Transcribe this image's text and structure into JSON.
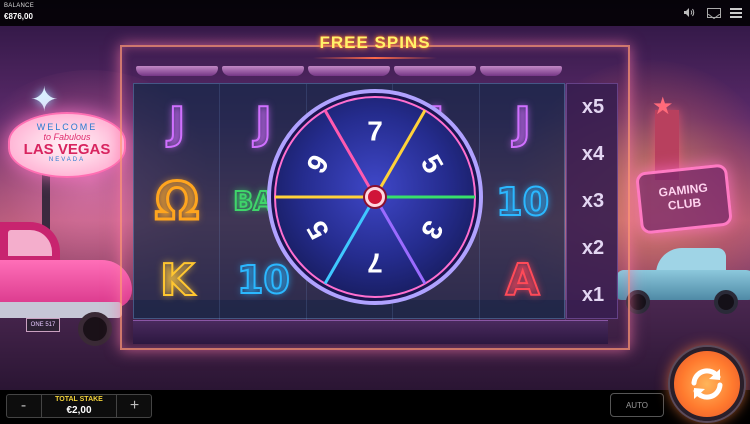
{
  "top_bar": {
    "balance_label": "BALANCE",
    "balance_value": "€876,00",
    "icons": [
      "speaker-icon",
      "mail-icon",
      "menu-icon"
    ]
  },
  "game": {
    "title": "FREE SPINS",
    "reels": [
      [
        "J",
        "Ω",
        "K"
      ],
      [
        "J",
        "BAR",
        "10"
      ],
      [
        "",
        "",
        ""
      ],
      [
        "J",
        "10",
        ""
      ],
      [
        "J",
        "10",
        "A"
      ]
    ],
    "multipliers": [
      "x5",
      "x4",
      "x3",
      "x2",
      "x1"
    ],
    "wheel_values": [
      "7",
      "5",
      "3",
      "7",
      "5",
      "9"
    ],
    "scene": {
      "vegas_sign": [
        "WELCOME",
        "to Fabulous",
        "LAS VEGAS",
        "NEVADA"
      ],
      "club_sign": [
        "GAMING",
        "CLUB"
      ],
      "license_plate": "ONE 517"
    }
  },
  "controls": {
    "minus_label": "-",
    "plus_label": "+",
    "total_stake_label": "TOTAL STAKE",
    "total_stake_value": "€2,00",
    "auto_label": "AUTO"
  },
  "colors": {
    "title": "#fff36a",
    "accent_orange": "#ff7a2e",
    "stake_label": "#f2d23a"
  }
}
